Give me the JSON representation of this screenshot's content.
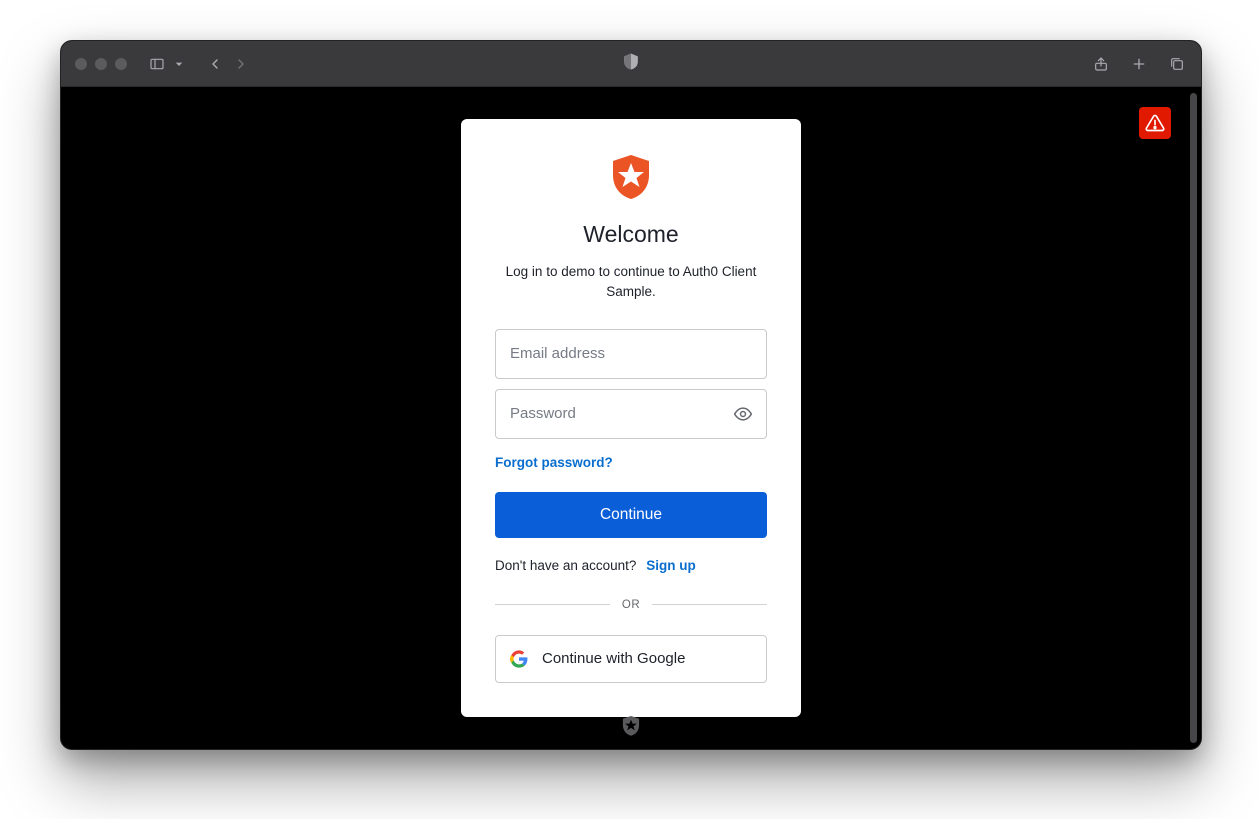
{
  "login": {
    "title": "Welcome",
    "subtitle": "Log in to demo to continue to Auth0 Client Sample.",
    "email_placeholder": "Email address",
    "email_value": "",
    "password_placeholder": "Password",
    "password_value": "",
    "forgot_label": "Forgot password?",
    "continue_label": "Continue",
    "signup_prompt": "Don't have an account?",
    "signup_link": "Sign up",
    "divider_label": "OR",
    "google_label": "Continue with Google"
  },
  "colors": {
    "accent": "#0a5ed7",
    "link": "#0a6ecf",
    "logo": "#eb5424",
    "alert": "#e11900"
  }
}
